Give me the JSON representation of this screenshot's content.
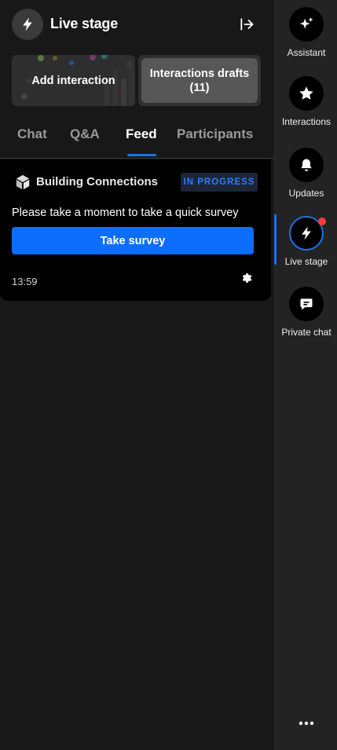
{
  "header": {
    "title": "Live stage",
    "icon": "bolt-icon",
    "collapse_icon": "collapse-panel-icon"
  },
  "actions": {
    "add_interaction_label": "Add interaction",
    "drafts_label": "Interactions drafts",
    "drafts_count": "(11)"
  },
  "tabs": [
    {
      "label": "Chat",
      "active": false
    },
    {
      "label": "Q&A",
      "active": false
    },
    {
      "label": "Feed",
      "active": true
    },
    {
      "label": "Participants",
      "active": false
    }
  ],
  "feed_card": {
    "icon": "cube-icon",
    "title": "Building Connections",
    "status": "IN PROGRESS",
    "message": "Please take a moment to take a quick survey",
    "button_label": "Take survey",
    "time": "13:59",
    "settings_icon": "gear-icon"
  },
  "rail": {
    "items": [
      {
        "label": "Assistant",
        "icon": "sparkle-icon"
      },
      {
        "label": "Interactions",
        "icon": "star-icon"
      },
      {
        "label": "Updates",
        "icon": "bell-icon"
      },
      {
        "label": "Live stage",
        "icon": "bolt-icon",
        "active": true,
        "notification": true
      },
      {
        "label": "Private chat",
        "icon": "chat-bubble-icon"
      }
    ],
    "more_icon": "more-dots-icon"
  },
  "colors": {
    "accent": "#1a73e8",
    "button_blue": "#0d6efd",
    "status_text": "#2f7bff",
    "notification": "#ff3b3b"
  }
}
